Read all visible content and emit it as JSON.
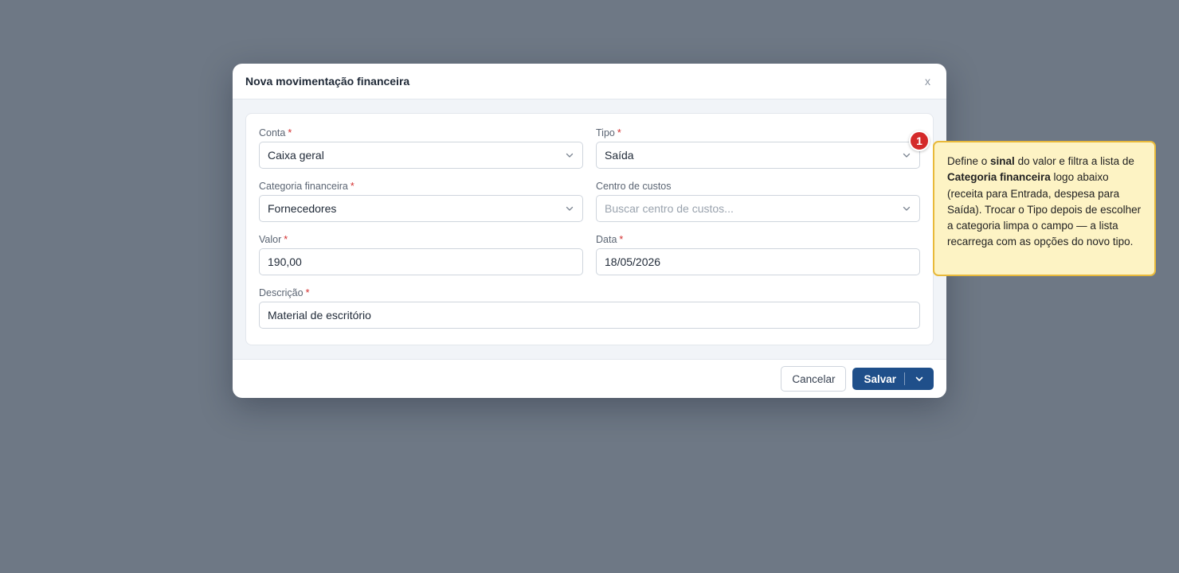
{
  "modal": {
    "title": "Nova movimentação financeira",
    "close_label": "x"
  },
  "form": {
    "conta": {
      "label": "Conta",
      "required_mark": "*",
      "value": "Caixa geral"
    },
    "tipo": {
      "label": "Tipo",
      "required_mark": "*",
      "value": "Saída"
    },
    "categoria": {
      "label": "Categoria financeira",
      "required_mark": "*",
      "value": "Fornecedores"
    },
    "centro": {
      "label": "Centro de custos",
      "placeholder": "Buscar centro de custos..."
    },
    "valor": {
      "label": "Valor",
      "required_mark": "*",
      "value": "190,00"
    },
    "data": {
      "label": "Data",
      "required_mark": "*",
      "value": "18/05/2026"
    },
    "descricao": {
      "label": "Descrição",
      "required_mark": "*",
      "value": "Material de escritório"
    }
  },
  "footer": {
    "cancel_label": "Cancelar",
    "save_label": "Salvar"
  },
  "annotation": {
    "badge_number": "1",
    "parts": {
      "t1": "Define o ",
      "b1": "sinal",
      "t2": " do valor e filtra a lista de ",
      "b2": "Categoria financeira",
      "t3": " logo abaixo (receita para Entrada, despesa para Saída). Trocar o Tipo depois de escolher a categoria limpa o campo — a lista recarrega com as opções do novo tipo."
    }
  },
  "icons": {
    "select_chevron": "chevron-down-icon",
    "close": "close-icon"
  },
  "colors": {
    "overlay": "#6e7885",
    "primary_button": "#1f4f8a",
    "required_mark": "#d32f2f",
    "badge": "#d42a2a",
    "tooltip_bg": "#fdf3c4",
    "tooltip_border": "#e8b93a"
  }
}
